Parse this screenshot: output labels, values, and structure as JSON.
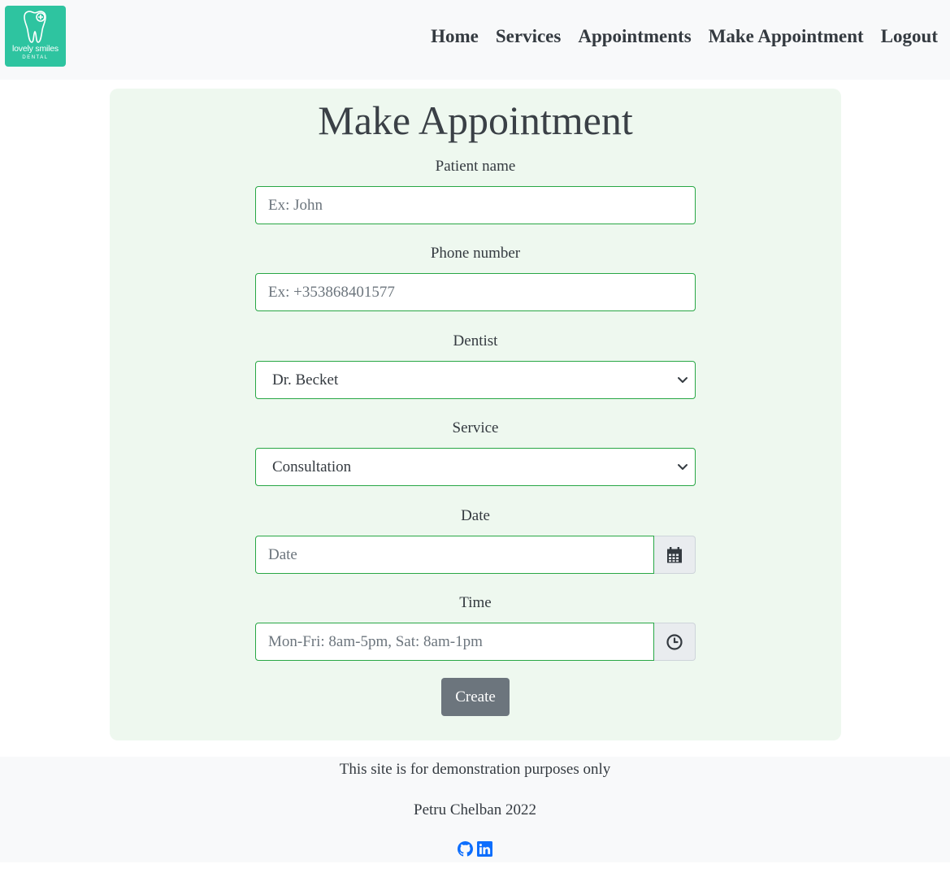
{
  "brand": {
    "logo_text": "lovely smiles",
    "logo_subtext": "DENTAL",
    "logo_color": "#2ec4a0"
  },
  "nav": {
    "items": [
      {
        "label": "Home"
      },
      {
        "label": "Services"
      },
      {
        "label": "Appointments"
      },
      {
        "label": "Make Appointment"
      },
      {
        "label": "Logout"
      }
    ]
  },
  "form": {
    "title": "Make Appointment",
    "patient_name": {
      "label": "Patient name",
      "placeholder": "Ex: John",
      "value": ""
    },
    "phone": {
      "label": "Phone number",
      "placeholder": "Ex: +353868401577",
      "value": ""
    },
    "dentist": {
      "label": "Dentist",
      "selected": "Dr. Becket"
    },
    "service": {
      "label": "Service",
      "selected": "Consultation"
    },
    "date": {
      "label": "Date",
      "placeholder": "Date",
      "icon": "calendar-icon"
    },
    "time": {
      "label": "Time",
      "placeholder": "Mon-Fri: 8am-5pm, Sat: 8am-1pm",
      "icon": "clock-icon"
    },
    "submit_label": "Create",
    "accent_color": "#28a745",
    "card_bg": "#eef8ef"
  },
  "footer": {
    "disclaimer": "This site is for demonstration purposes only",
    "credit": "Petru Chelban 2022",
    "social": [
      {
        "icon": "github-icon",
        "color": "#0d6efd"
      },
      {
        "icon": "linkedin-icon",
        "color": "#0d6efd"
      }
    ]
  }
}
